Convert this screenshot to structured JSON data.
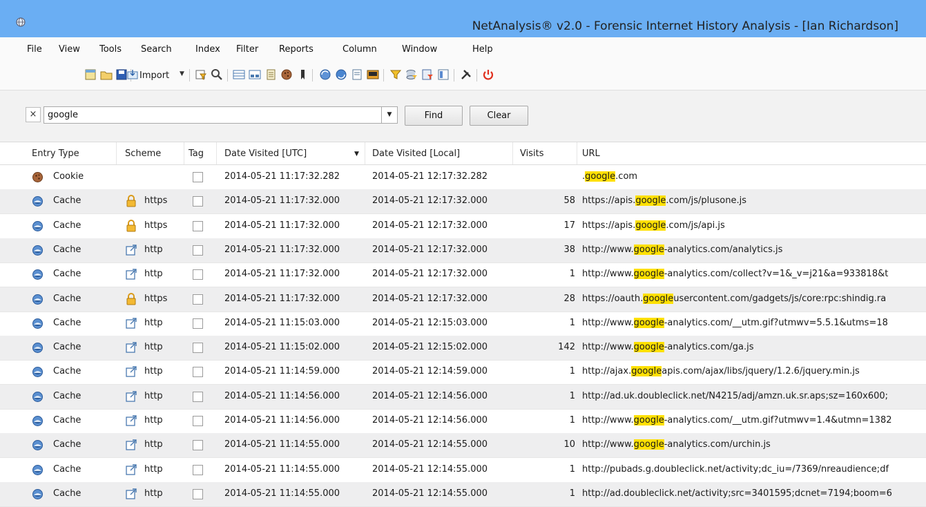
{
  "window": {
    "title": "NetAnalysis® v2.0 - Forensic Internet History Analysis - [Ian Richardson]"
  },
  "menu": [
    "File",
    "View",
    "Tools",
    "Search",
    "Index",
    "Filter",
    "Reports",
    "Column",
    "Window",
    "Help"
  ],
  "toolbar": {
    "import_label": "Import"
  },
  "search": {
    "value": "google",
    "find_label": "Find",
    "clear_label": "Clear",
    "clear_glyph": "×"
  },
  "columns": {
    "entry_type": "Entry Type",
    "scheme": "Scheme",
    "tag": "Tag",
    "date_utc": "Date Visited [UTC]",
    "date_local": "Date Visited [Local]",
    "visits": "Visits",
    "url": "URL"
  },
  "highlight_term": "google",
  "rows": [
    {
      "type": "Cookie",
      "scheme": "",
      "utc": "2014-05-21 11:17:32.282",
      "local": "2014-05-21 12:17:32.282",
      "visits": "",
      "url": ".google.com"
    },
    {
      "type": "Cache",
      "scheme": "https",
      "utc": "2014-05-21 11:17:32.000",
      "local": "2014-05-21 12:17:32.000",
      "visits": "58",
      "url": "https://apis.google.com/js/plusone.js"
    },
    {
      "type": "Cache",
      "scheme": "https",
      "utc": "2014-05-21 11:17:32.000",
      "local": "2014-05-21 12:17:32.000",
      "visits": "17",
      "url": "https://apis.google.com/js/api.js"
    },
    {
      "type": "Cache",
      "scheme": "http",
      "utc": "2014-05-21 11:17:32.000",
      "local": "2014-05-21 12:17:32.000",
      "visits": "38",
      "url": "http://www.google-analytics.com/analytics.js"
    },
    {
      "type": "Cache",
      "scheme": "http",
      "utc": "2014-05-21 11:17:32.000",
      "local": "2014-05-21 12:17:32.000",
      "visits": "1",
      "url": "http://www.google-analytics.com/collect?v=1&_v=j21&a=933818&t"
    },
    {
      "type": "Cache",
      "scheme": "https",
      "utc": "2014-05-21 11:17:32.000",
      "local": "2014-05-21 12:17:32.000",
      "visits": "28",
      "url": "https://oauth.googleusercontent.com/gadgets/js/core:rpc:shindig.ra"
    },
    {
      "type": "Cache",
      "scheme": "http",
      "utc": "2014-05-21 11:15:03.000",
      "local": "2014-05-21 12:15:03.000",
      "visits": "1",
      "url": "http://www.google-analytics.com/__utm.gif?utmwv=5.5.1&utms=18"
    },
    {
      "type": "Cache",
      "scheme": "http",
      "utc": "2014-05-21 11:15:02.000",
      "local": "2014-05-21 12:15:02.000",
      "visits": "142",
      "url": "http://www.google-analytics.com/ga.js"
    },
    {
      "type": "Cache",
      "scheme": "http",
      "utc": "2014-05-21 11:14:59.000",
      "local": "2014-05-21 12:14:59.000",
      "visits": "1",
      "url": "http://ajax.googleapis.com/ajax/libs/jquery/1.2.6/jquery.min.js"
    },
    {
      "type": "Cache",
      "scheme": "http",
      "utc": "2014-05-21 11:14:56.000",
      "local": "2014-05-21 12:14:56.000",
      "visits": "1",
      "url": "http://ad.uk.doubleclick.net/N4215/adj/amzn.uk.sr.aps;sz=160x600;"
    },
    {
      "type": "Cache",
      "scheme": "http",
      "utc": "2014-05-21 11:14:56.000",
      "local": "2014-05-21 12:14:56.000",
      "visits": "1",
      "url": "http://www.google-analytics.com/__utm.gif?utmwv=1.4&utmn=1382"
    },
    {
      "type": "Cache",
      "scheme": "http",
      "utc": "2014-05-21 11:14:55.000",
      "local": "2014-05-21 12:14:55.000",
      "visits": "10",
      "url": "http://www.google-analytics.com/urchin.js"
    },
    {
      "type": "Cache",
      "scheme": "http",
      "utc": "2014-05-21 11:14:55.000",
      "local": "2014-05-21 12:14:55.000",
      "visits": "1",
      "url": "http://pubads.g.doubleclick.net/activity;dc_iu=/7369/nreaudience;df"
    },
    {
      "type": "Cache",
      "scheme": "http",
      "utc": "2014-05-21 11:14:55.000",
      "local": "2014-05-21 12:14:55.000",
      "visits": "1",
      "url": "http://ad.doubleclick.net/activity;src=3401595;dcnet=7194;boom=6"
    }
  ]
}
